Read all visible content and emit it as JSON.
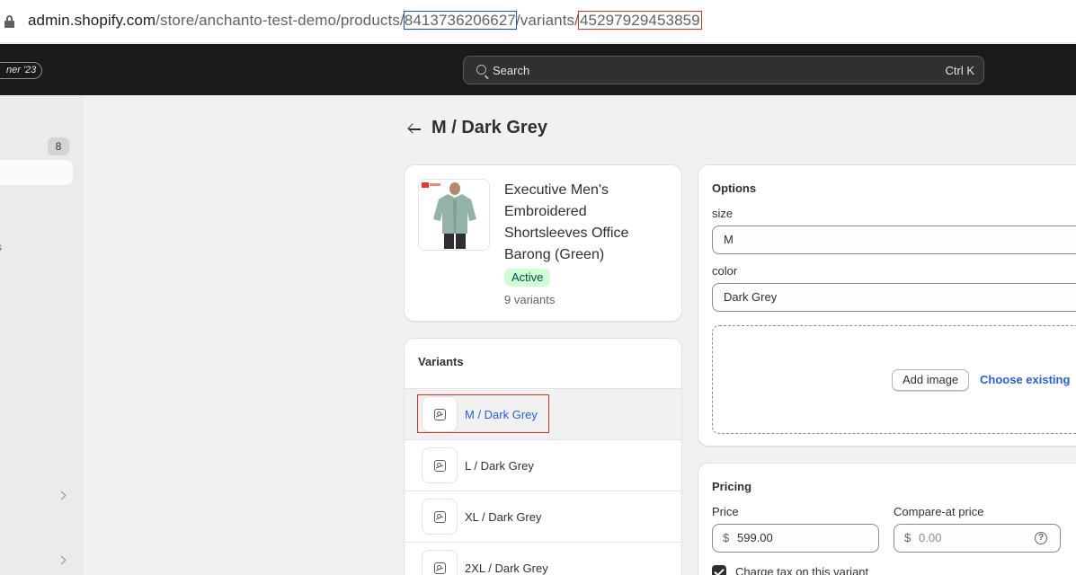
{
  "browser": {
    "url_host": "admin.shopify.com",
    "url_path_1": "/store/anchanto-test-demo/products/",
    "product_id": "8413736206627",
    "url_path_2": "/variants/",
    "variant_id": "45297929453859"
  },
  "topbar": {
    "edition_pill": "ner '23",
    "search_placeholder": "Search",
    "search_shortcut": "Ctrl K"
  },
  "sidebar": {
    "badge_count": "8",
    "fragment": "s"
  },
  "page": {
    "title": "M / Dark Grey"
  },
  "product": {
    "name": "Executive Men's Embroidered Shortsleeves Office Barong (Green)",
    "status": "Active",
    "variant_count": "9 variants"
  },
  "variants": {
    "title": "Variants",
    "items": [
      {
        "label": "M / Dark Grey",
        "selected": true
      },
      {
        "label": "L / Dark Grey",
        "selected": false
      },
      {
        "label": "XL / Dark Grey",
        "selected": false
      },
      {
        "label": "2XL / Dark Grey",
        "selected": false
      }
    ]
  },
  "options": {
    "title": "Options",
    "size_label": "size",
    "size_value": "M",
    "color_label": "color",
    "color_value": "Dark Grey",
    "add_image": "Add image",
    "choose_existing": "Choose existing"
  },
  "pricing": {
    "title": "Pricing",
    "price_label": "Price",
    "currency": "$",
    "price_value": "599.00",
    "compare_label": "Compare-at price",
    "compare_placeholder": "0.00",
    "charge_tax_label": "Charge tax on this variant"
  },
  "colors": {
    "accent_link": "#2c5fce",
    "active_badge_bg": "#cdfed4",
    "annotation_red": "#d0342c",
    "annotation_blue": "#2b4dbb"
  }
}
